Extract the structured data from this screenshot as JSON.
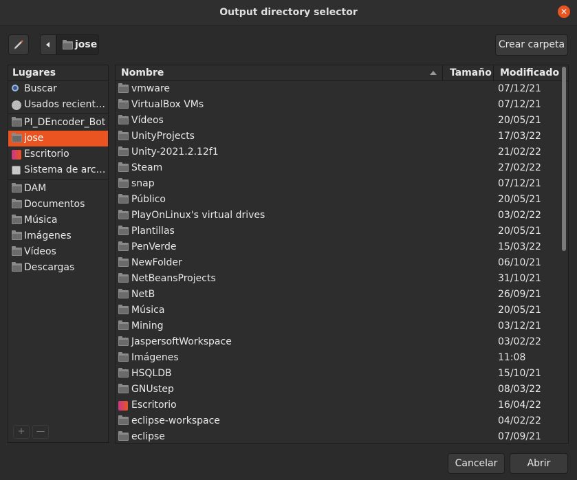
{
  "window": {
    "title": "Output directory selector"
  },
  "toolbar": {
    "current_folder": "jose",
    "create_folder_label": "Crear carpeta"
  },
  "sidebar": {
    "heading": "Lugares",
    "items": [
      {
        "label": "Buscar",
        "icon": "search-icon"
      },
      {
        "label": "Usados recientemente",
        "icon": "recent-icon"
      },
      {
        "label": "PI_DEncoder_Bot",
        "icon": "folder-icon"
      },
      {
        "label": "jose",
        "icon": "folder-icon",
        "selected": true
      },
      {
        "label": "Escritorio",
        "icon": "desktop-icon"
      },
      {
        "label": "Sistema de archivos",
        "icon": "disk-icon"
      },
      {
        "label": "DAM",
        "icon": "folder-icon"
      },
      {
        "label": "Documentos",
        "icon": "folder-icon"
      },
      {
        "label": "Música",
        "icon": "folder-icon"
      },
      {
        "label": "Imágenes",
        "icon": "folder-icon"
      },
      {
        "label": "Vídeos",
        "icon": "folder-icon"
      },
      {
        "label": "Descargas",
        "icon": "folder-icon"
      }
    ],
    "footer": {
      "add": "+",
      "remove": "—"
    }
  },
  "files": {
    "columns": {
      "name": "Nombre",
      "size": "Tamaño",
      "modified": "Modificado"
    },
    "rows": [
      {
        "name": "vmware",
        "modified": "07/12/21",
        "icon": "folder-icon"
      },
      {
        "name": "VirtualBox VMs",
        "modified": "07/12/21",
        "icon": "folder-icon"
      },
      {
        "name": "Vídeos",
        "modified": "20/05/21",
        "icon": "folder-icon"
      },
      {
        "name": "UnityProjects",
        "modified": "17/03/22",
        "icon": "folder-icon"
      },
      {
        "name": "Unity-2021.2.12f1",
        "modified": "21/02/22",
        "icon": "folder-icon"
      },
      {
        "name": "Steam",
        "modified": "27/02/22",
        "icon": "folder-icon"
      },
      {
        "name": "snap",
        "modified": "07/12/21",
        "icon": "folder-icon"
      },
      {
        "name": "Público",
        "modified": "20/05/21",
        "icon": "folder-icon"
      },
      {
        "name": "PlayOnLinux's virtual drives",
        "modified": "03/02/22",
        "icon": "folder-icon"
      },
      {
        "name": "Plantillas",
        "modified": "20/05/21",
        "icon": "folder-icon"
      },
      {
        "name": "PenVerde",
        "modified": "15/03/22",
        "icon": "folder-icon"
      },
      {
        "name": "NewFolder",
        "modified": "06/10/21",
        "icon": "folder-icon"
      },
      {
        "name": "NetBeansProjects",
        "modified": "31/10/21",
        "icon": "folder-icon"
      },
      {
        "name": "NetB",
        "modified": "26/09/21",
        "icon": "folder-icon"
      },
      {
        "name": "Música",
        "modified": "20/05/21",
        "icon": "folder-icon"
      },
      {
        "name": "Mining",
        "modified": "03/12/21",
        "icon": "folder-icon"
      },
      {
        "name": "JaspersoftWorkspace",
        "modified": "03/02/22",
        "icon": "folder-icon"
      },
      {
        "name": "Imágenes",
        "modified": "11:08",
        "icon": "folder-icon"
      },
      {
        "name": "HSQLDB",
        "modified": "15/10/21",
        "icon": "folder-icon"
      },
      {
        "name": "GNUstep",
        "modified": "08/03/22",
        "icon": "folder-icon"
      },
      {
        "name": "Escritorio",
        "modified": "16/04/22",
        "icon": "desktop-icon"
      },
      {
        "name": "eclipse-workspace",
        "modified": "04/02/22",
        "icon": "folder-icon"
      },
      {
        "name": "eclipse",
        "modified": "07/09/21",
        "icon": "folder-icon"
      }
    ]
  },
  "buttons": {
    "cancel": "Cancelar",
    "open": "Abrir"
  },
  "colors": {
    "accent": "#e95420",
    "background": "#2b2b2b"
  }
}
